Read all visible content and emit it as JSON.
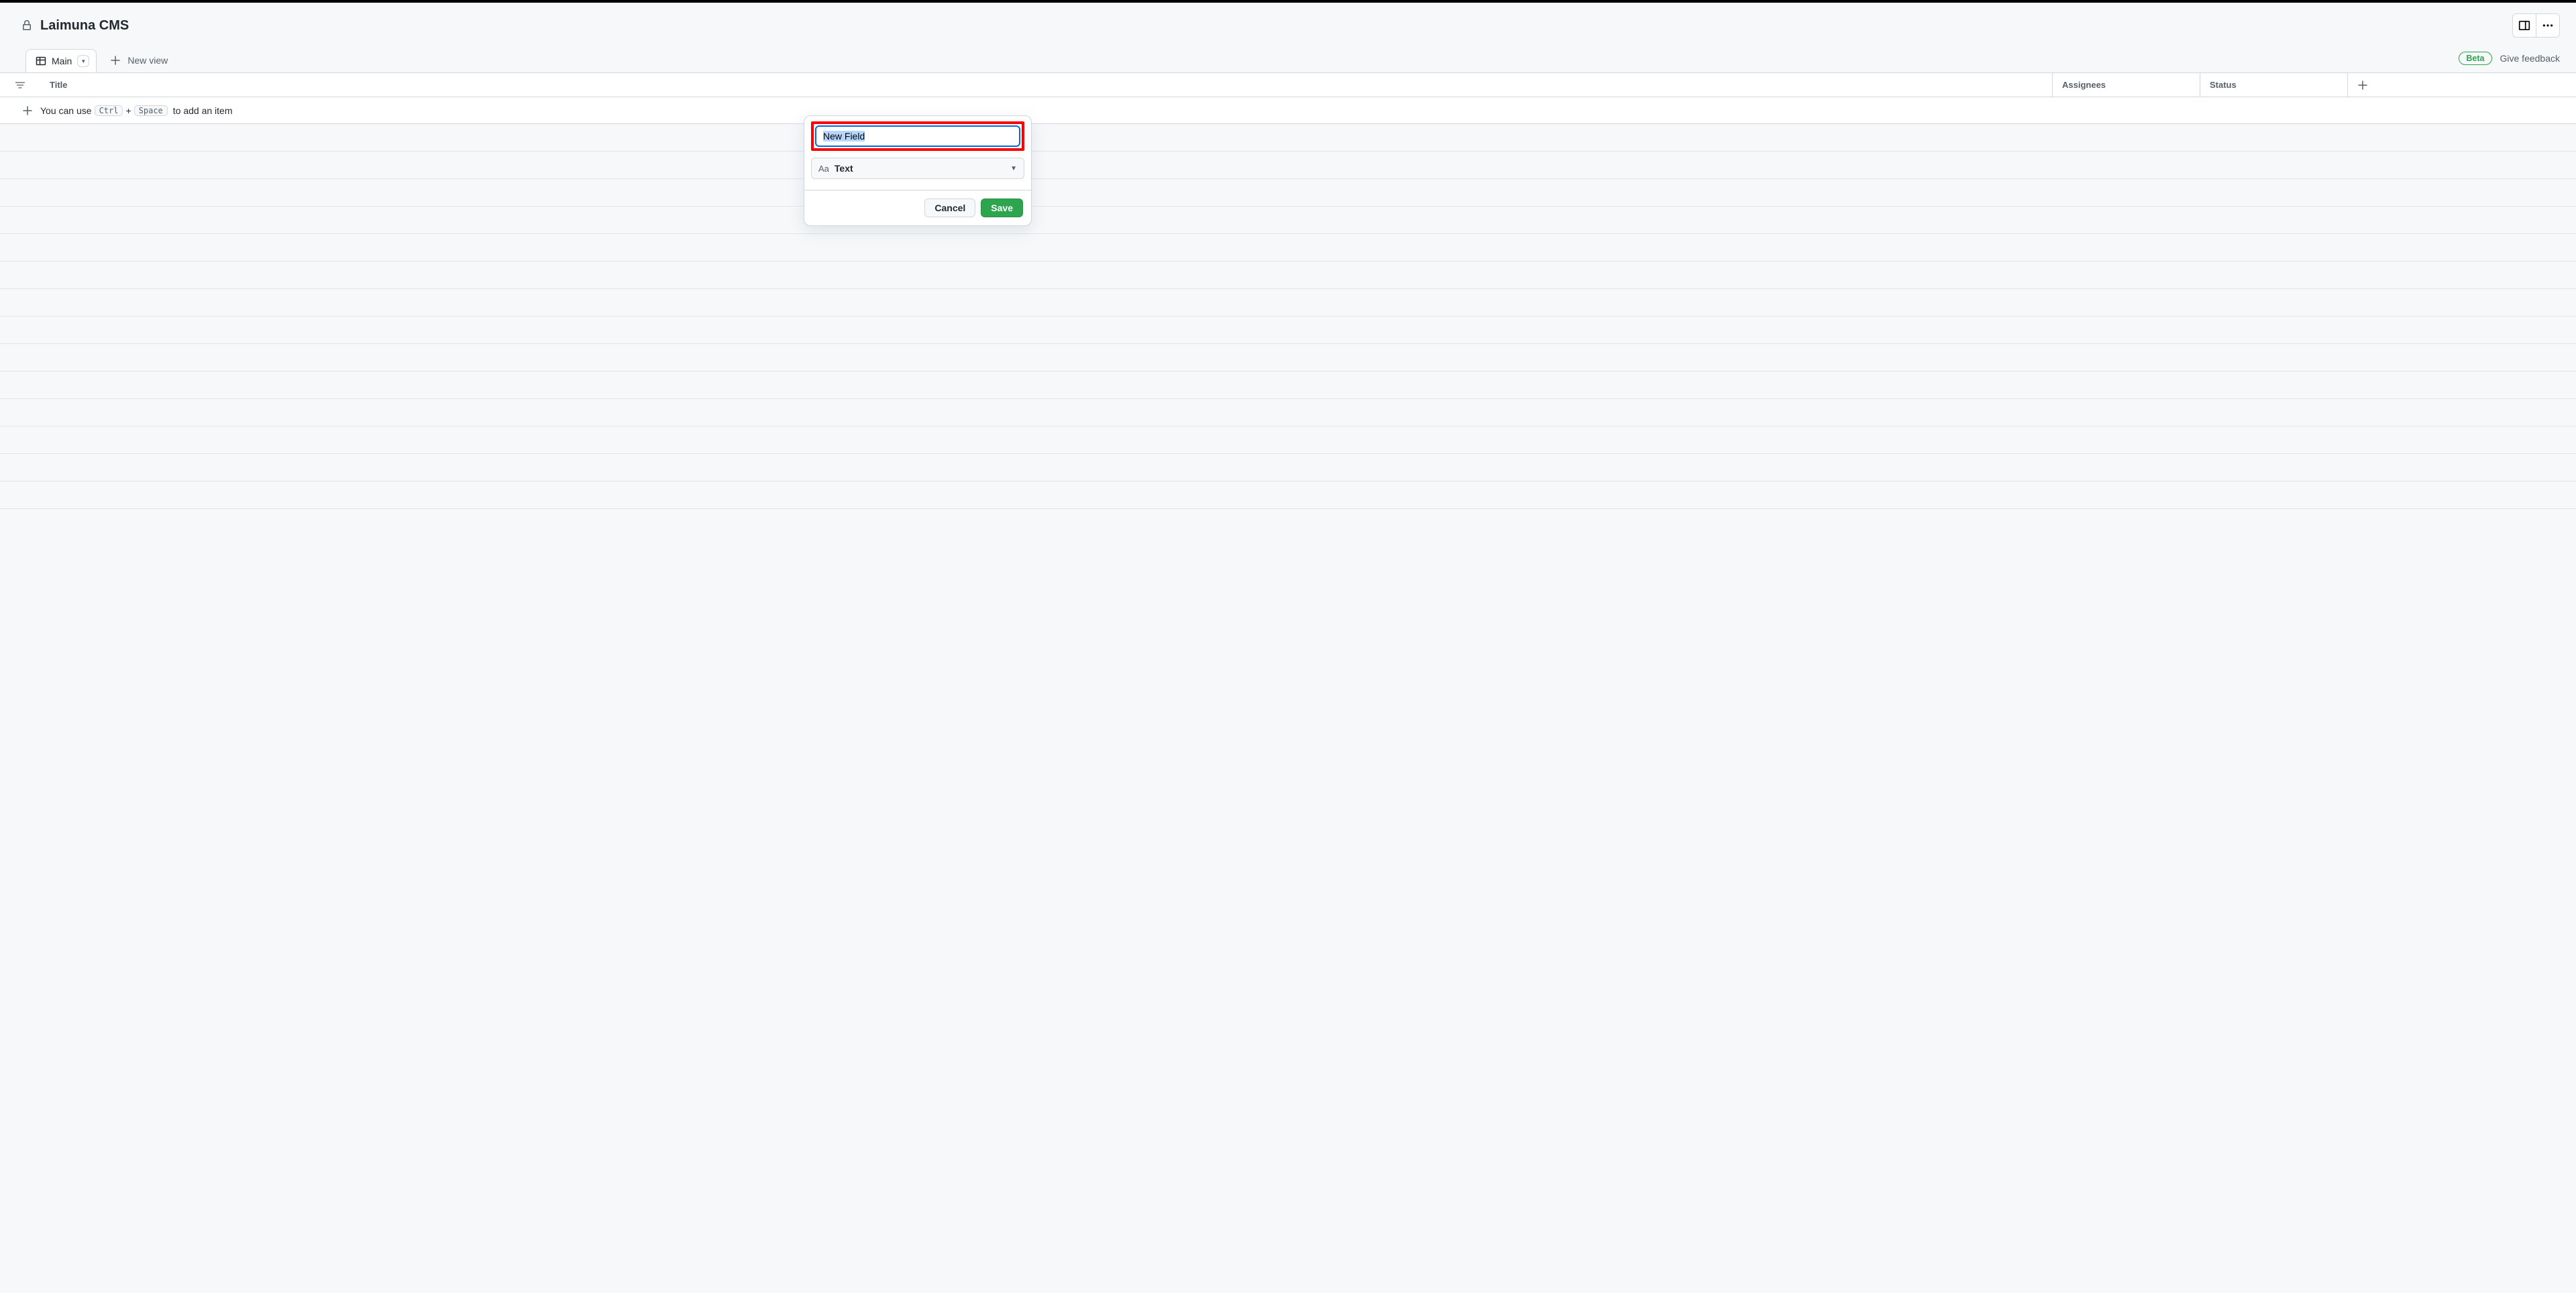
{
  "header": {
    "project_title": "Laimuna CMS"
  },
  "views": {
    "active_tab_label": "Main",
    "new_view_label": "New view",
    "beta_badge": "Beta",
    "give_feedback": "Give feedback"
  },
  "columns": {
    "title": "Title",
    "assignees": "Assignees",
    "status": "Status"
  },
  "add_row": {
    "prefix": "You can use",
    "kbd1": "Ctrl",
    "plus": "+",
    "kbd2": "Space",
    "suffix": "to add an item"
  },
  "popover": {
    "field_name_value": "New Field",
    "field_type_prefix": "Aa",
    "field_type_label": "Text",
    "cancel_label": "Cancel",
    "save_label": "Save"
  }
}
